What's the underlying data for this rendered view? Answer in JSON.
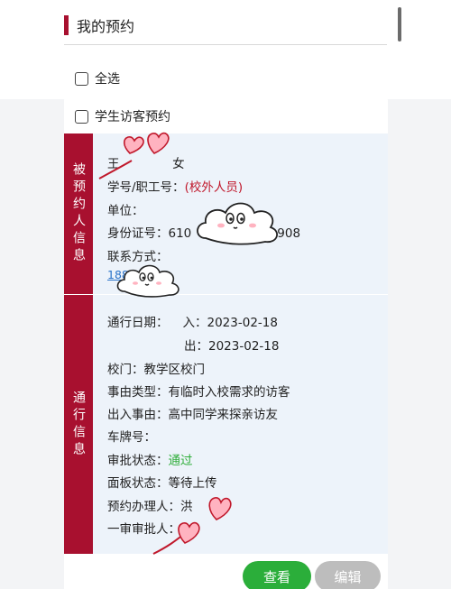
{
  "section": {
    "title": "我的预约"
  },
  "select_all": {
    "label": "全选"
  },
  "card": {
    "type_label": "学生访客预约",
    "visitor_section_label": "被预约人信息",
    "pass_section_label": "通行信息",
    "visitor": {
      "name_prefix": "王",
      "gender": "女",
      "id_label": "学号/职工号：",
      "id_value": "(校外人员)",
      "unit_label": "单位：",
      "idcard_label": "身份证号：",
      "idcard_prefix": "610",
      "idcard_suffix": "908",
      "contact_label": "联系方式：",
      "phone_prefix": "188"
    },
    "pass": {
      "date_label": "通行日期：",
      "entry_label": "入：",
      "entry_date": "2023-02-18",
      "exit_label": "出：",
      "exit_date": "2023-02-18",
      "gate_label": "校门：",
      "gate_value": "教学区校门",
      "reason_type_label": "事由类型：",
      "reason_type_value": "有临时入校需求的访客",
      "reason_label": "出入事由：",
      "reason_value": "高中同学来探亲访友",
      "plate_label": "车牌号：",
      "approval_label": "审批状态：",
      "approval_value": "通过",
      "panel_label": "面板状态：",
      "panel_value": "等待上传",
      "handler_label": "预约办理人：",
      "handler_prefix": "洪",
      "approver_label": "一审审批人："
    },
    "colors": {
      "accent": "#a8102f",
      "approved": "#2fae3a",
      "link": "#2a73c9"
    }
  },
  "buttons": {
    "view": "查看",
    "edit": "编辑"
  },
  "stickers": [
    "heart-sticker",
    "cloud-face-sticker"
  ]
}
